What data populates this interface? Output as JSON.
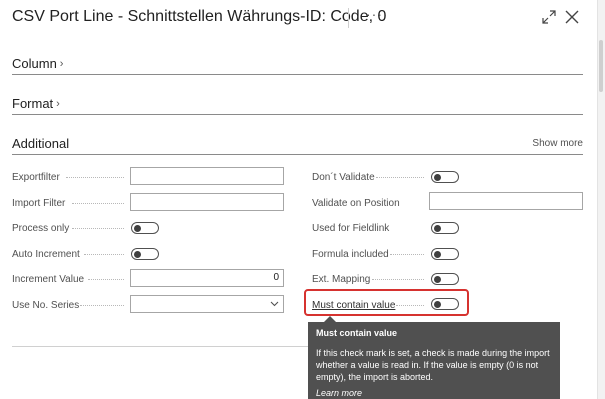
{
  "header": {
    "title": "CSV Port Line - Schnittstellen Währungs-ID: Code, 0",
    "more_glyph": "···",
    "expand_icon": "expand-icon",
    "close_icon": "close-icon"
  },
  "sections": {
    "column": {
      "label": "Column"
    },
    "format": {
      "label": "Format"
    },
    "additional": {
      "label": "Additional",
      "show_more": "Show more"
    }
  },
  "left_fields": {
    "export_filter": {
      "label": "Exportfilter",
      "value": ""
    },
    "import_filter": {
      "label": "Import Filter",
      "value": ""
    },
    "process_only": {
      "label": "Process only",
      "toggle": false
    },
    "auto_increment": {
      "label": "Auto Increment",
      "toggle": false
    },
    "increment_value": {
      "label": "Increment Value",
      "value": "0"
    },
    "use_no_series": {
      "label": "Use No. Series",
      "value": ""
    }
  },
  "right_fields": {
    "dont_validate": {
      "label": "Don´t Validate",
      "toggle": false
    },
    "validate_on_position": {
      "label": "Validate on Position",
      "value": ""
    },
    "used_for_fieldlink": {
      "label": "Used for Fieldlink",
      "toggle": false
    },
    "formula_included": {
      "label": "Formula included",
      "toggle": false
    },
    "ext_mapping": {
      "label": "Ext. Mapping",
      "toggle": false
    },
    "must_contain_value": {
      "label": "Must contain value",
      "toggle": false
    }
  },
  "tooltip": {
    "title": "Must contain value",
    "body": "If this check mark is set, a check is made during the import whether a value is read in. If the value is empty (0 is not empty), the import is aborted.",
    "learn_more": "Learn more"
  },
  "colors": {
    "highlight": "#d6322f",
    "tooltip_bg": "#505050",
    "toggle_knob": "#404040"
  }
}
